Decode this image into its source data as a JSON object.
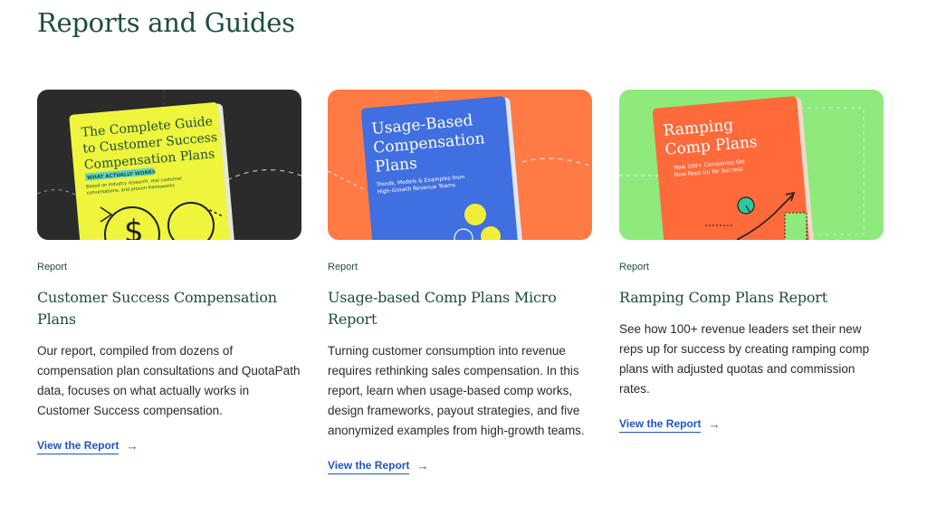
{
  "header": {
    "title": "Reports and Guides"
  },
  "cards": [
    {
      "tag": "Report",
      "title": "Customer Success Compensation Plans",
      "description": "Our report, compiled from dozens of compensation plan consultations and QuotaPath data, focuses on what actually works in Customer Success compensation.",
      "link": "View the Report",
      "cover": {
        "title_line1": "The Complete Guide",
        "title_line2": "to Customer Success",
        "title_line3": "Compensation Plans",
        "badge": "WHAT ACTUALLY WORKS",
        "sub_line1": "Based on industry research, real customer",
        "sub_line2": "conversations, and proven frameworks",
        "symbol": "$",
        "bg_color": "#2b2b2b",
        "book_color": "#eef53c"
      }
    },
    {
      "tag": "Report",
      "title": "Usage-based Comp Plans Micro Report",
      "description": "Turning customer consumption into revenue requires rethinking sales compensation. In this report, learn when usage-based comp works, design frameworks, payout strategies, and five anonymized examples from high-growth teams.",
      "link": "View the Report",
      "cover": {
        "title_line1": "Usage-Based",
        "title_line2": "Compensation",
        "title_line3": "Plans",
        "sub_line1": "Trends, Models & Examples from",
        "sub_line2": "High-Growth Revenue Teams",
        "bg_color": "#ff7a45",
        "book_color": "#3f6fe0"
      }
    },
    {
      "tag": "Report",
      "title": "Ramping Comp Plans Report",
      "description": "See how 100+ revenue leaders set their new reps up for success by creating ramping comp plans with adjusted quotas and commission rates.",
      "link": "View the Report",
      "cover": {
        "title_line1": "Ramping",
        "title_line2": "Comp Plans",
        "sub_line1": "How 100+ Companies Set",
        "sub_line2": "New Reps Up for Success",
        "bg_color": "#8eea7b",
        "book_color": "#ff6a3a"
      }
    }
  ]
}
